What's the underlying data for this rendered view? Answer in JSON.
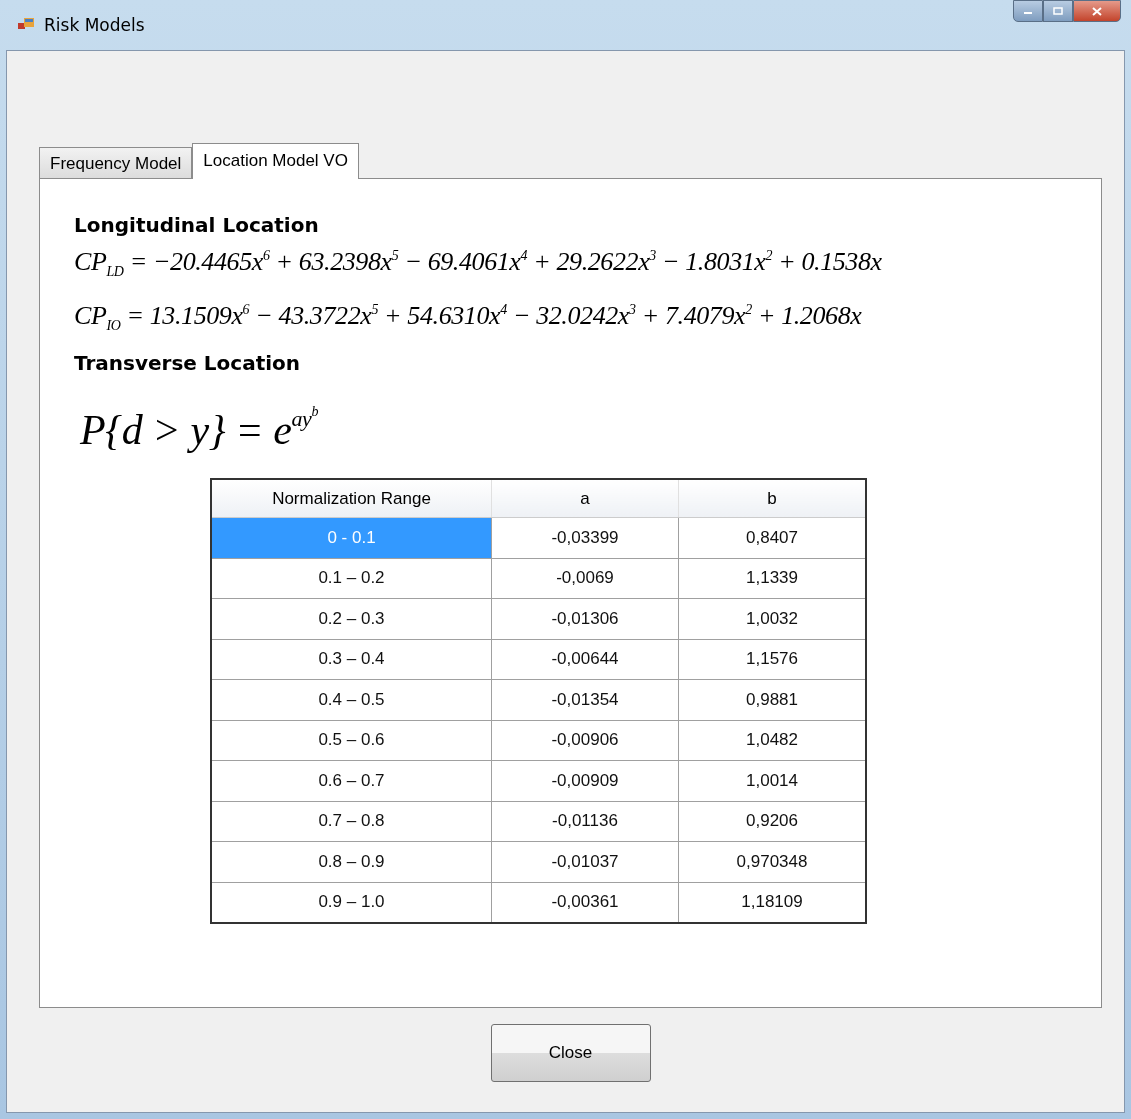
{
  "window": {
    "title": "Risk Models"
  },
  "tabs": [
    {
      "label": "Frequency Model",
      "selected": false
    },
    {
      "label": "Location Model VO",
      "selected": true
    }
  ],
  "sections": [
    {
      "heading": "Longitudinal Location",
      "formulas": [
        "CP$_{LD}$ = −20.4465x$^{6}$ + 63.2398x$^{5}$ − 69.4061x$^{4}$ + 29.2622x$^{3}$ − 1.8031x$^{2}$ + 0.1538x",
        "CP$_{IO}$ = 13.1509x$^{6}$ − 43.3722x$^{5}$ + 54.6310x$^{4}$ − 32.0242x$^{3}$ + 7.4079x$^{2}$ + 1.2068x"
      ]
    },
    {
      "heading": "Transverse Location",
      "formula_base": "P{d > y} = e",
      "formula_exponent": "ay",
      "formula_exponent_power": "b"
    }
  ],
  "table": {
    "columns": [
      "Normalization Range",
      "a",
      "b"
    ],
    "rows": [
      {
        "cells": [
          "0 - 0.1",
          "-0,03399",
          "0,8407"
        ],
        "selected": true
      },
      {
        "cells": [
          "0.1 – 0.2",
          "-0,0069",
          "1,1339"
        ],
        "selected": false
      },
      {
        "cells": [
          "0.2 – 0.3",
          "-0,01306",
          "1,0032"
        ],
        "selected": false
      },
      {
        "cells": [
          "0.3 – 0.4",
          "-0,00644",
          "1,1576"
        ],
        "selected": false
      },
      {
        "cells": [
          "0.4 – 0.5",
          "-0,01354",
          "0,9881"
        ],
        "selected": false
      },
      {
        "cells": [
          "0.5 – 0.6",
          "-0,00906",
          "1,0482"
        ],
        "selected": false
      },
      {
        "cells": [
          "0.6 – 0.7",
          "-0,00909",
          "1,0014"
        ],
        "selected": false
      },
      {
        "cells": [
          "0.7 – 0.8",
          "-0,01136",
          "0,9206"
        ],
        "selected": false
      },
      {
        "cells": [
          "0.8 – 0.9",
          "-0,01037",
          "0,970348"
        ],
        "selected": false
      },
      {
        "cells": [
          "0.9 – 1.0",
          "-0,00361",
          "1,18109"
        ],
        "selected": false
      }
    ]
  },
  "buttons": [
    "Close"
  ]
}
